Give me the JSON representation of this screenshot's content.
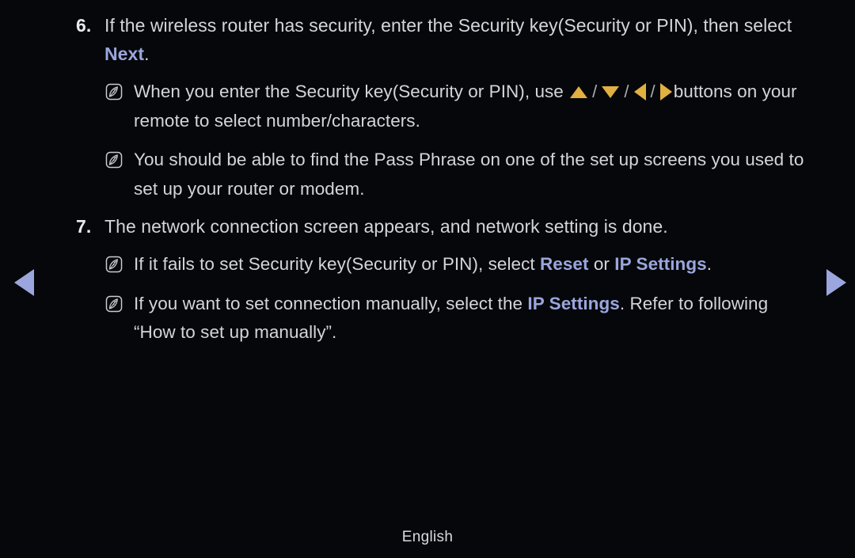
{
  "background_color": "#06070a",
  "text_color": "#d3d5da",
  "accent_color": "#9aa6dd",
  "arrow_color": "#e0b040",
  "steps": [
    {
      "number": "6.",
      "text_before": "If the wireless router has security, enter the Security key(Security or PIN), then select ",
      "keyword": "Next",
      "text_after": "."
    },
    {
      "number": "7.",
      "text": "The network connection screen appears, and network setting is done."
    }
  ],
  "notes": [
    {
      "icon": "note-feather-icon",
      "text_before": "When you enter the Security key(Security or PIN), use ",
      "arrows": [
        "arrow-up-icon",
        "arrow-down-icon",
        "arrow-left-icon",
        "arrow-right-icon"
      ],
      "arrow_separator": "/",
      "text_after": "buttons on your remote to select number/characters."
    },
    {
      "icon": "note-feather-icon",
      "text": "You should be able to find the Pass Phrase on one of the set up screens you used to set up your router or modem."
    },
    {
      "icon": "note-feather-icon",
      "text_before": "If it fails to set Security key(Security or PIN), select ",
      "keyword1": "Reset",
      "text_middle": " or ",
      "keyword2": "IP Settings",
      "text_after": "."
    },
    {
      "icon": "note-feather-icon",
      "text_before": "If you want to set connection manually, select the ",
      "keyword": "IP Settings",
      "text_after": ". Refer to following “How to set up manually”."
    }
  ],
  "navigation": {
    "previous_label": "previous-page",
    "next_label": "next-page"
  },
  "footer": {
    "language": "English"
  }
}
